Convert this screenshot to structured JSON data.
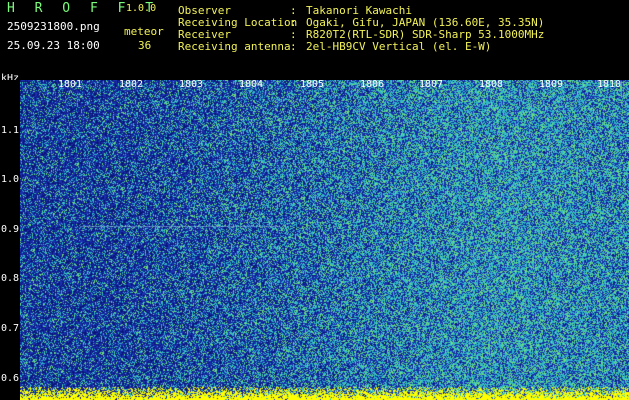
{
  "header": {
    "app_title": "H R O F F T",
    "version": "1.0.0",
    "file_name": "2509231800.png",
    "timestamp": "25.09.23 18:00",
    "mode_label": "meteor",
    "count": "36"
  },
  "info": [
    {
      "key": "Observer",
      "value": "Takanori Kawachi"
    },
    {
      "key": "Receiving Location",
      "value": "Ogaki, Gifu, JAPAN (136.60E, 35.35N)"
    },
    {
      "key": "Receiver",
      "value": "R820T2(RTL-SDR) SDR-Sharp 53.1000MHz"
    },
    {
      "key": "Receiving antenna",
      "value": "2el-HB9CV Vertical (el. E-W)"
    }
  ],
  "separator": ":",
  "axis": {
    "freq_unit": "kHz",
    "freq_labels": [
      "1.1",
      "1.0",
      "0.9",
      "0.8",
      "0.7",
      "0.6"
    ],
    "time_labels": [
      "1801",
      "1802",
      "1803",
      "1804",
      "1805",
      "1806",
      "1807",
      "1808",
      "1809",
      "1810"
    ]
  },
  "colors": {
    "background": "#000000",
    "label_green": "#7cfc7c",
    "label_yellow": "#f2f25a",
    "noise_deep_blue": "#1a2fb0",
    "noise_cyan": "#2fb8c8",
    "noise_green": "#6fe07a",
    "baseline_yellow": "#ffff00"
  }
}
